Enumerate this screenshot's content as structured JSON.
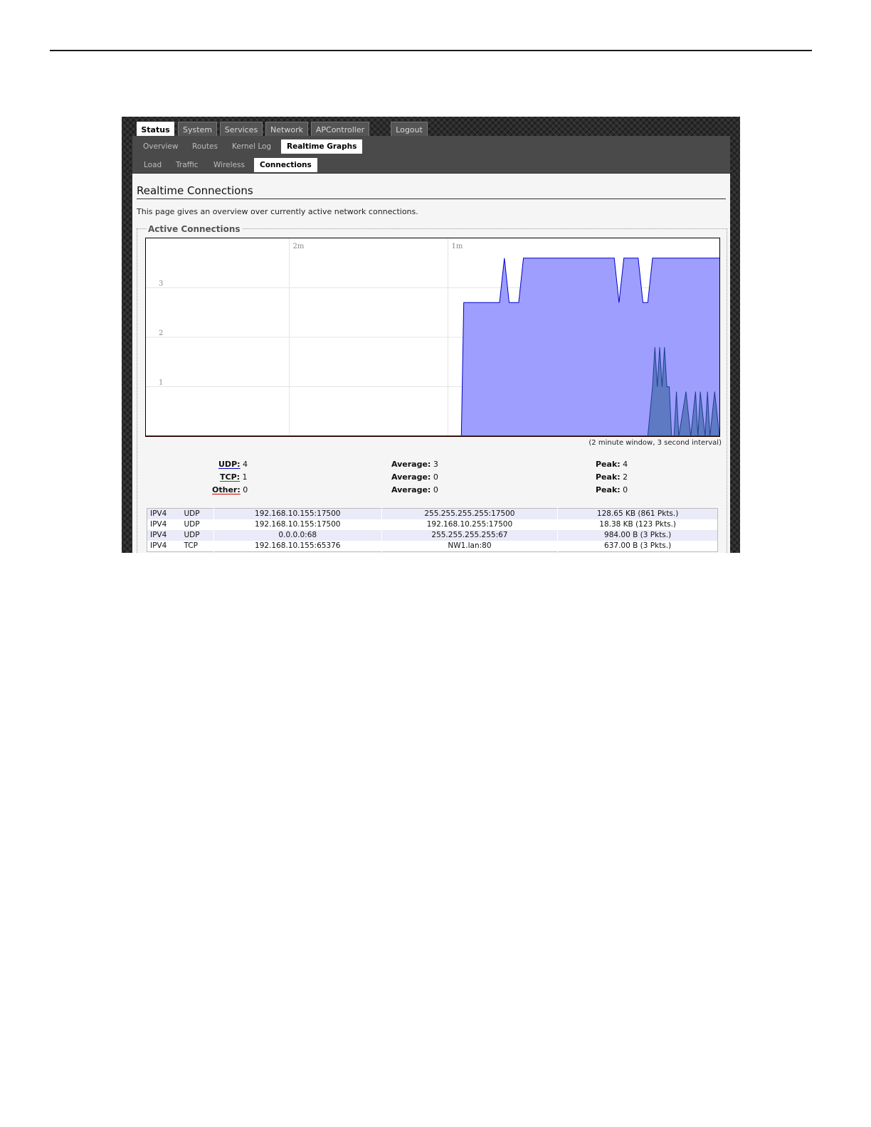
{
  "tabs": [
    {
      "label": "Status",
      "active": true
    },
    {
      "label": "System"
    },
    {
      "label": "Services"
    },
    {
      "label": "Network"
    },
    {
      "label": "APController"
    },
    {
      "label": "Logout"
    }
  ],
  "subtabs": [
    {
      "label": "Overview"
    },
    {
      "label": "Routes"
    },
    {
      "label": "Kernel Log"
    },
    {
      "label": "Realtime Graphs",
      "active": true
    }
  ],
  "subtabs2": [
    {
      "label": "Load"
    },
    {
      "label": "Traffic"
    },
    {
      "label": "Wireless"
    },
    {
      "label": "Connections",
      "active": true
    }
  ],
  "page": {
    "title": "Realtime Connections",
    "description": "This page gives an overview over currently active network connections."
  },
  "section": {
    "legend": "Active Connections",
    "window_note": "(2 minute window, 3 second interval)"
  },
  "chart_data": {
    "type": "area",
    "x_tick_labels": [
      "2m",
      "1m"
    ],
    "y_tick_labels": [
      "3",
      "2",
      "1"
    ],
    "ylim": [
      0,
      4
    ],
    "xlim": [
      0,
      120
    ],
    "grid": true,
    "series": [
      {
        "name": "UDP",
        "color": "#9999ff",
        "stroke": "#0000cc",
        "x": [
          0,
          65.5,
          66,
          66.5,
          67,
          70,
          72,
          74,
          75,
          76,
          78,
          79,
          80,
          98,
          99,
          100,
          101,
          103,
          104,
          105,
          106,
          120
        ],
        "y": [
          0,
          0,
          0,
          2.7,
          2.7,
          2.7,
          2.7,
          2.7,
          3.6,
          2.7,
          2.7,
          3.6,
          3.6,
          3.6,
          2.7,
          3.6,
          3.6,
          3.6,
          2.7,
          2.7,
          3.6,
          3.6
        ]
      },
      {
        "name": "TCP",
        "color": "#5a78c0",
        "stroke": "#1f3f8f",
        "x": [
          104,
          105,
          106,
          106.5,
          107,
          107.5,
          108,
          108.5,
          109,
          109.5,
          110,
          110.5,
          111,
          111.5,
          113,
          114,
          115,
          115.5,
          116,
          117,
          117.5,
          118,
          119,
          120
        ],
        "y": [
          0,
          0,
          1,
          1.8,
          1.0,
          1.8,
          1.0,
          1.8,
          1.0,
          1.0,
          0,
          0,
          0.9,
          0,
          0.9,
          0,
          0.9,
          0,
          0.9,
          0,
          0.9,
          0,
          0.9,
          0
        ]
      },
      {
        "name": "Other",
        "color": "#cc0000",
        "stroke": "#cc0000",
        "x": [
          0,
          120
        ],
        "y": [
          0,
          0
        ]
      }
    ]
  },
  "stats": {
    "udp": {
      "label": "UDP:",
      "value": "4",
      "avg_label": "Average:",
      "avg": "3",
      "peak_label": "Peak:",
      "peak": "4"
    },
    "tcp": {
      "label": "TCP:",
      "value": "1",
      "avg_label": "Average:",
      "avg": "0",
      "peak_label": "Peak:",
      "peak": "2"
    },
    "other": {
      "label": "Other:",
      "value": "0",
      "avg_label": "Average:",
      "avg": "0",
      "peak_label": "Peak:",
      "peak": "0"
    }
  },
  "connections": [
    {
      "family": "IPV4",
      "proto": "UDP",
      "source": "192.168.10.155:17500",
      "dest": "255.255.255.255:17500",
      "transfer": "128.65 KB (861 Pkts.)"
    },
    {
      "family": "IPV4",
      "proto": "UDP",
      "source": "192.168.10.155:17500",
      "dest": "192.168.10.255:17500",
      "transfer": "18.38 KB (123 Pkts.)"
    },
    {
      "family": "IPV4",
      "proto": "UDP",
      "source": "0.0.0.0:68",
      "dest": "255.255.255.255:67",
      "transfer": "984.00 B (3 Pkts.)"
    },
    {
      "family": "IPV4",
      "proto": "TCP",
      "source": "192.168.10.155:65376",
      "dest": "NW1.lan:80",
      "transfer": "637.00 B (3 Pkts.)"
    }
  ]
}
